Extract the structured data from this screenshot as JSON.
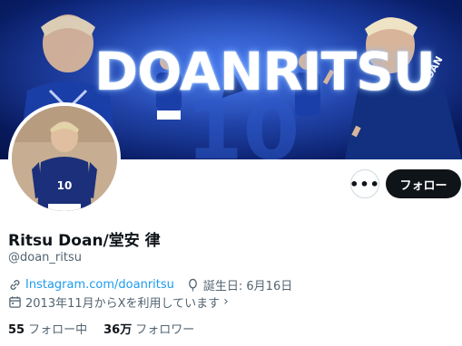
{
  "banner": {
    "title": "DOANRITSU",
    "jersey_number": "10",
    "player_name": "DOAN"
  },
  "avatar": {
    "jersey_number": "10"
  },
  "actions": {
    "more_label": "•••",
    "follow_label": "フォロー"
  },
  "profile": {
    "display_name": "Ritsu Doan/堂安 律",
    "handle": "@doan_ritsu",
    "website": "Instagram.com/doanritsu",
    "birthday": "誕生日: 6月16日",
    "joined": "2013年11月からXを利用しています",
    "joined_chevron": "›"
  },
  "stats": {
    "following_count": "55",
    "following_label": "フォロー中",
    "followers_count": "36万",
    "followers_label": "フォロワー"
  },
  "colors": {
    "link": "#1d9bf0",
    "secondary_text": "#536471",
    "primary_text": "#0f1419",
    "banner_blue": "#0d2a8a"
  }
}
